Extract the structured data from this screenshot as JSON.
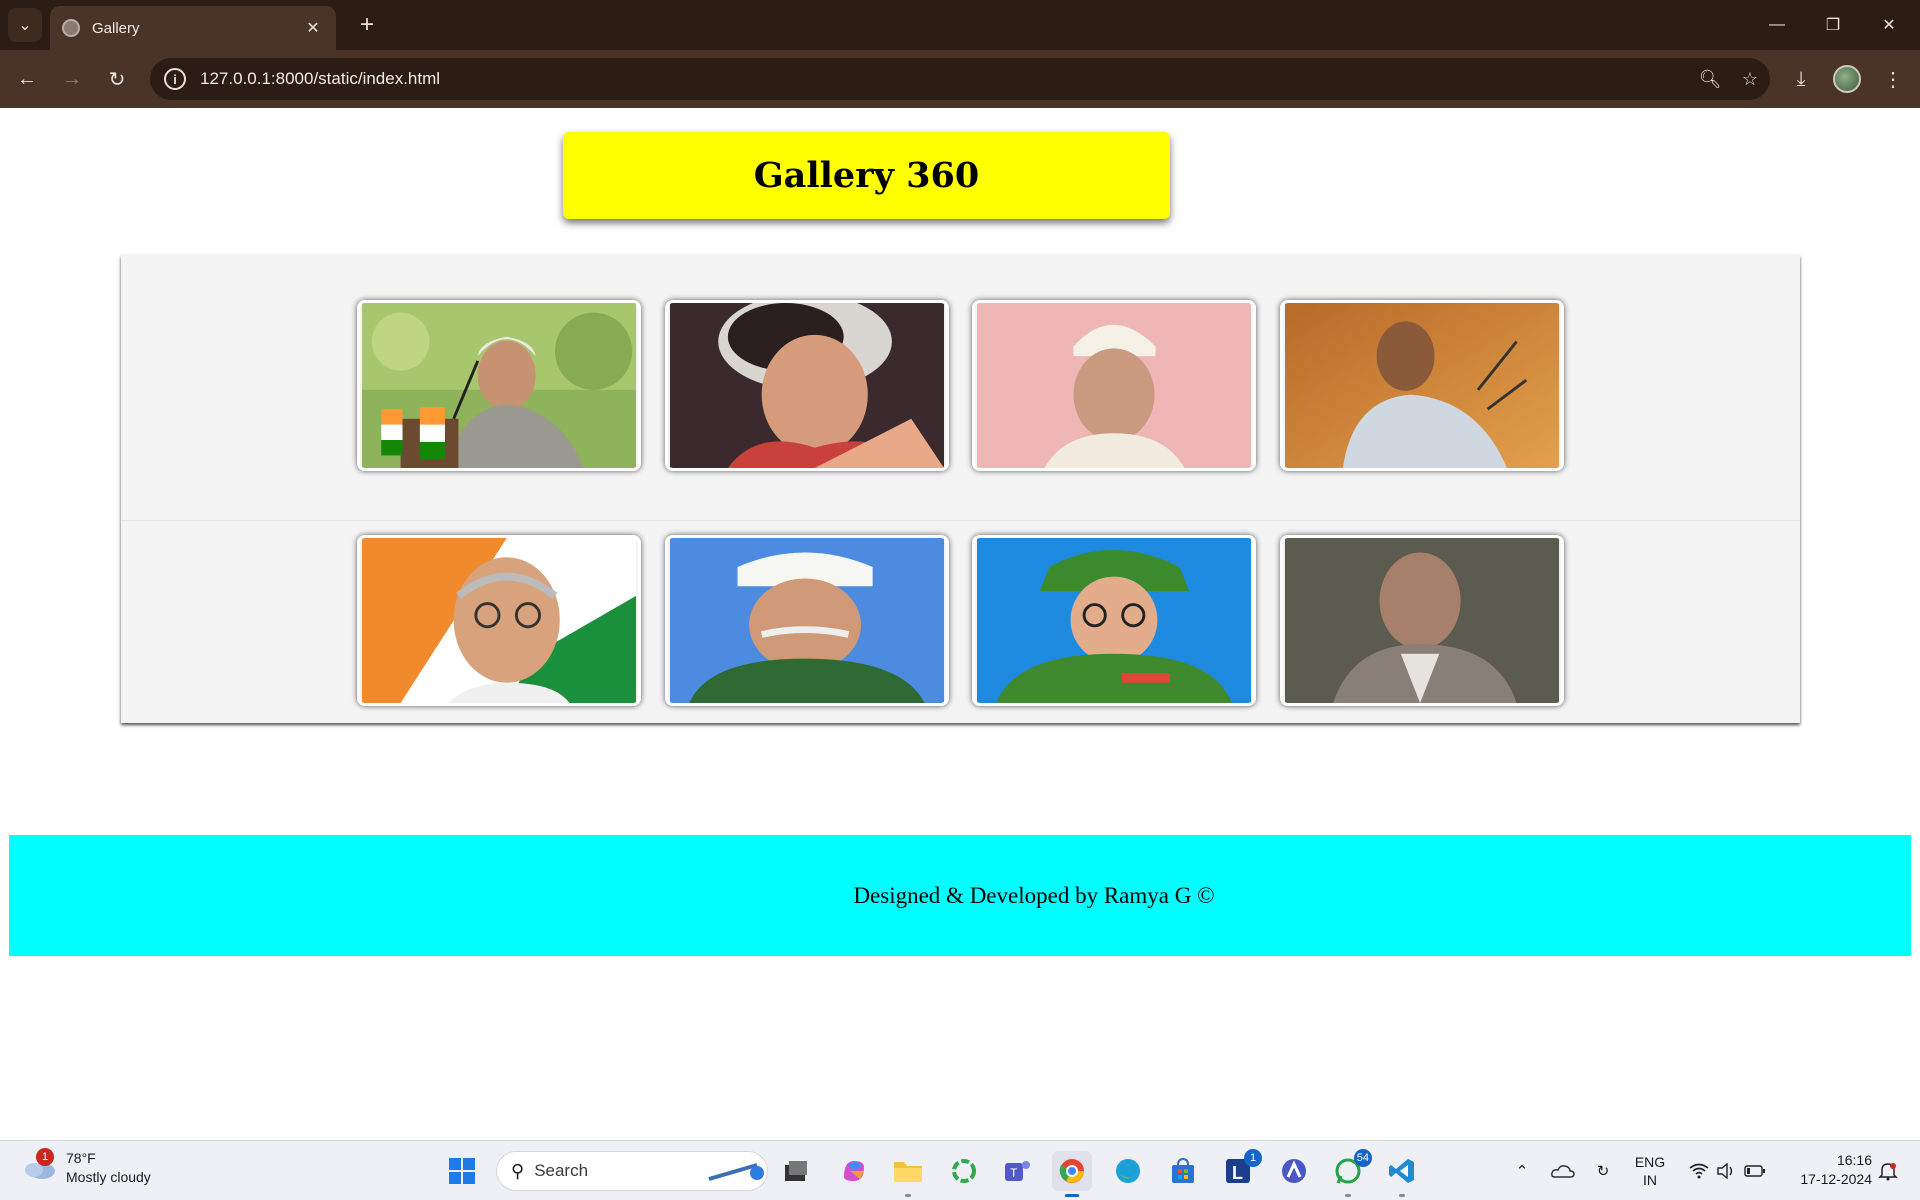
{
  "browser": {
    "tab_title": "Gallery",
    "url": "127.0.0.1:8000/static/index.html"
  },
  "page": {
    "heading": "Gallery 360",
    "footer_text": "Designed & Developed by Ramya G ©",
    "colors": {
      "header_bg": "#ffff00",
      "footer_bg": "#00ffff",
      "gallery_bg": "#f4f4f4"
    },
    "gallery": {
      "rows": [
        [
          "portrait-1",
          "portrait-2",
          "portrait-3",
          "portrait-4"
        ],
        [
          "portrait-5",
          "portrait-6",
          "portrait-7",
          "portrait-8"
        ]
      ]
    }
  },
  "taskbar": {
    "weather_temp": "78°F",
    "weather_desc": "Mostly cloudy",
    "weather_badge": "1",
    "search_label": "Search",
    "lang_line1": "ENG",
    "lang_line2": "IN",
    "time": "16:16",
    "date": "17-12-2024",
    "badge_l": "1",
    "badge_whatsapp": "54"
  }
}
